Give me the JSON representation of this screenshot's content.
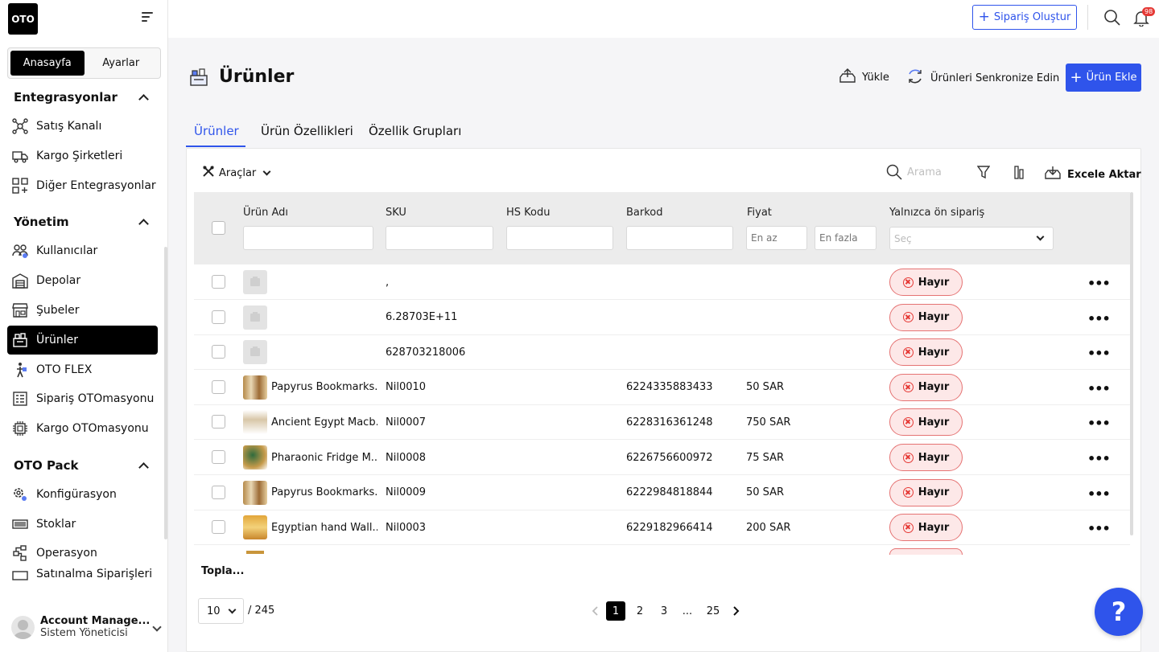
{
  "brand": {
    "logo_text": "OTO"
  },
  "sidebar": {
    "segment": {
      "home": "Anasayfa",
      "settings": "Ayarlar"
    },
    "sections": [
      {
        "title": "Entegrasyonlar"
      },
      {
        "title": "Yönetim"
      },
      {
        "title": "OTO Pack"
      }
    ],
    "integrations": [
      "Satış Kanalı",
      "Kargo Şirketleri",
      "Diğer Entegrasyonlar"
    ],
    "management": [
      "Kullanıcılar",
      "Depolar",
      "Şubeler",
      "Ürünler",
      "OTO FLEX",
      "Sipariş OTOmasyonu",
      "Kargo OTOmasyonu"
    ],
    "pack": [
      "Konfigürasyon",
      "Stoklar",
      "Operasyon",
      "Satınalma Siparişleri"
    ],
    "account": {
      "name": "Account Manage...",
      "role": "Sistem Yöneticisi"
    }
  },
  "topbar": {
    "create_order": "Sipariş Oluştur",
    "notification_count": "98"
  },
  "page": {
    "title": "Ürünler",
    "upload": "Yükle",
    "sync": "Ürünleri Senkronize Edin",
    "add": "Ürün Ekle"
  },
  "tabs": [
    "Ürünler",
    "Ürün Özellikleri",
    "Özellik Grupları"
  ],
  "toolbar": {
    "tools": "Araçlar",
    "search_placeholder": "Arama",
    "export": "Excele Aktar"
  },
  "table": {
    "headers": [
      "Ürün Adı",
      "SKU",
      "HS Kodu",
      "Barkod",
      "Fiyat",
      "Yalnızca ön sipariş"
    ],
    "filters": {
      "min": "En az",
      "max": "En fazla",
      "select": "Seç"
    },
    "rows": [
      {
        "name": "",
        "sku": ",",
        "hs": "",
        "barcode": "",
        "price": "",
        "preorder": "Hayır"
      },
      {
        "name": "",
        "sku": "6.28703E+11",
        "hs": "",
        "barcode": "",
        "price": "",
        "preorder": "Hayır"
      },
      {
        "name": "",
        "sku": "628703218006",
        "hs": "",
        "barcode": "",
        "price": "",
        "preorder": "Hayır"
      },
      {
        "name": "Papyrus Bookmarks...",
        "sku": "Nil0010",
        "hs": "",
        "barcode": "6224335883433",
        "price": "50 SAR",
        "preorder": "Hayır"
      },
      {
        "name": "Ancient Egypt Macb...",
        "sku": "Nil0007",
        "hs": "",
        "barcode": "6228316361248",
        "price": "750 SAR",
        "preorder": "Hayır"
      },
      {
        "name": "Pharaonic Fridge M...",
        "sku": "Nil0008",
        "hs": "",
        "barcode": "6226756600972",
        "price": "75 SAR",
        "preorder": "Hayır"
      },
      {
        "name": "Papyrus Bookmarks...",
        "sku": "Nil0009",
        "hs": "",
        "barcode": "6222984818844",
        "price": "50 SAR",
        "preorder": "Hayır"
      },
      {
        "name": "Egyptian hand Wall...",
        "sku": "Nil0003",
        "hs": "",
        "barcode": "6229182966414",
        "price": "200 SAR",
        "preorder": "Hayır"
      }
    ],
    "total_label": "Topla..."
  },
  "pagination": {
    "page_size": "10",
    "total": "/ 245",
    "pages": [
      "1",
      "2",
      "3",
      "...",
      "25"
    ]
  },
  "help": "?",
  "colors": {
    "accent": "#2f54eb",
    "danger": "#e53935"
  }
}
